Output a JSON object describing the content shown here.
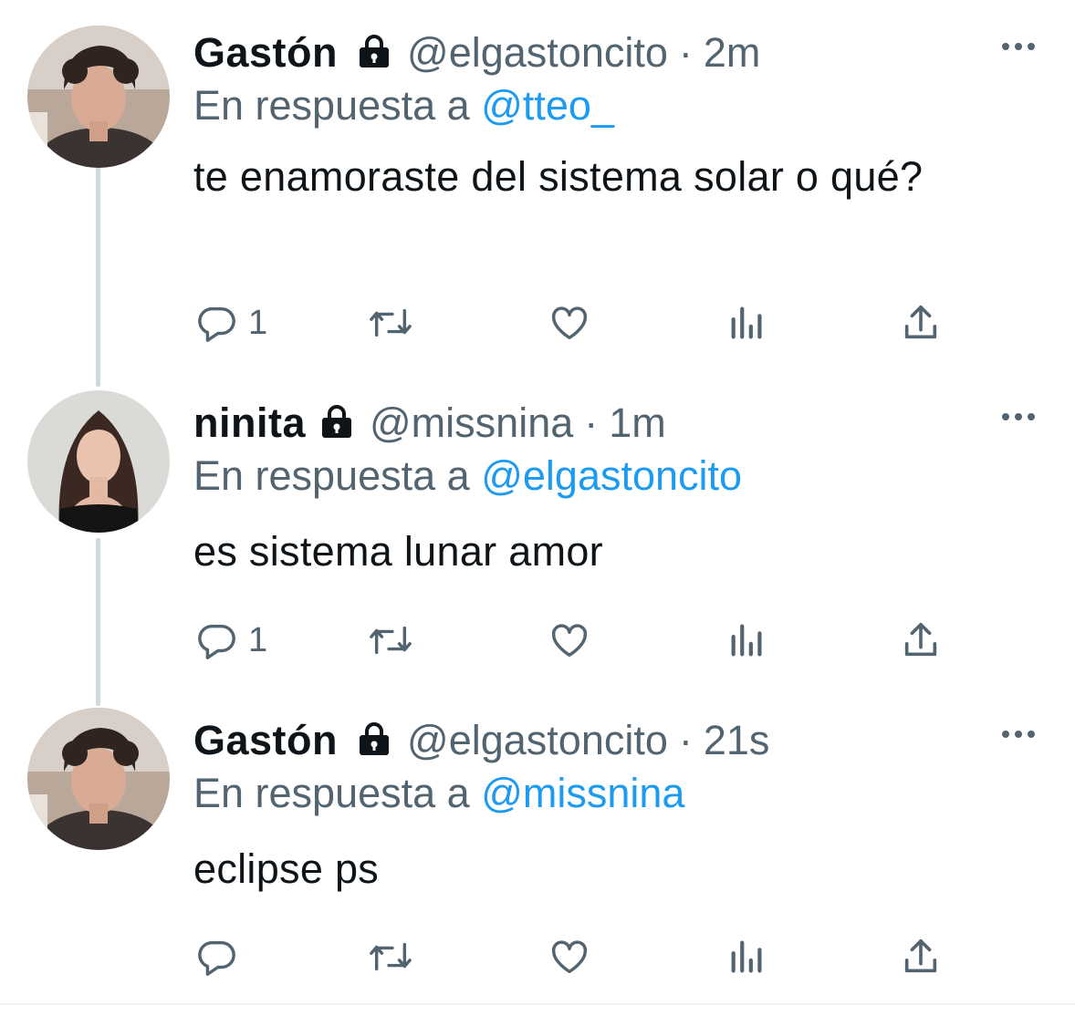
{
  "tweets": [
    {
      "name": "Gastón",
      "handle": "@elgastoncito",
      "separator": "·",
      "time": "2m",
      "reply_prefix": "En respuesta a",
      "reply_to": "@tteo_",
      "text": "te enamoraste del sistema solar o qué?",
      "reply_count": "1"
    },
    {
      "name": "ninita",
      "handle": "@missnina",
      "separator": "·",
      "time": "1m",
      "reply_prefix": "En respuesta a",
      "reply_to": "@elgastoncito",
      "text": "es sistema lunar amor",
      "reply_count": "1"
    },
    {
      "name": "Gastón",
      "handle": "@elgastoncito",
      "separator": "·",
      "time": "21s",
      "reply_prefix": "En respuesta a",
      "reply_to": "@missnina",
      "text": "eclipse ps",
      "reply_count": ""
    }
  ],
  "colors": {
    "secondary_text": "#536471",
    "link": "#1d9bf0",
    "thread_line": "#cfd9de"
  },
  "icons": [
    "lock-icon",
    "more-icon",
    "reply-icon",
    "retweet-icon",
    "like-icon",
    "analytics-icon",
    "share-icon"
  ]
}
